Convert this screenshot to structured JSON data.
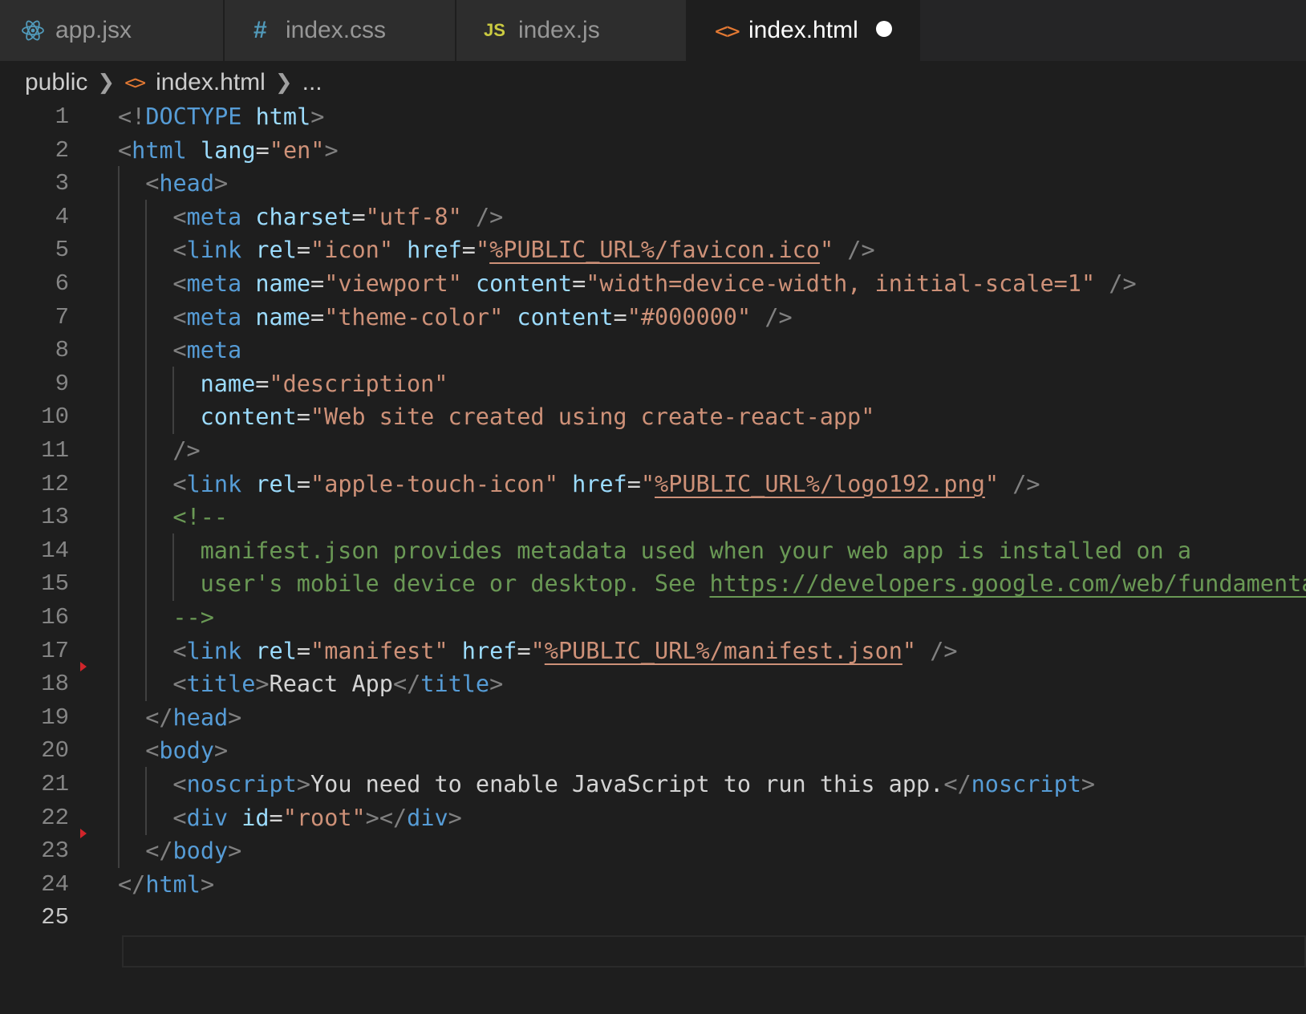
{
  "tabs": [
    {
      "label": "app.jsx",
      "icon": "react-icon"
    },
    {
      "label": "index.css",
      "icon": "css-hash-icon",
      "glyph": "#"
    },
    {
      "label": "index.js",
      "icon": "js-icon",
      "glyph": "JS"
    },
    {
      "label": "index.html",
      "icon": "html-icon",
      "glyph": "<>",
      "active": true,
      "unsaved": true
    }
  ],
  "breadcrumb": {
    "folder": "public",
    "file": "index.html",
    "more": "..."
  },
  "editor": {
    "current_line": 25,
    "lines": [
      {
        "n": "1",
        "indent": 0,
        "tokens": [
          [
            "punc",
            "<!"
          ],
          [
            "tag",
            "DOCTYPE"
          ],
          [
            "txt",
            " "
          ],
          [
            "attr",
            "html"
          ],
          [
            "punc",
            ">"
          ]
        ]
      },
      {
        "n": "2",
        "indent": 0,
        "tokens": [
          [
            "punc",
            "<"
          ],
          [
            "tag",
            "html"
          ],
          [
            "txt",
            " "
          ],
          [
            "attr",
            "lang"
          ],
          [
            "txt",
            "="
          ],
          [
            "str",
            "\"en\""
          ],
          [
            "punc",
            ">"
          ]
        ]
      },
      {
        "n": "3",
        "indent": 1,
        "tokens": [
          [
            "punc",
            "<"
          ],
          [
            "tag",
            "head"
          ],
          [
            "punc",
            ">"
          ]
        ]
      },
      {
        "n": "4",
        "indent": 2,
        "tokens": [
          [
            "punc",
            "<"
          ],
          [
            "tag",
            "meta"
          ],
          [
            "txt",
            " "
          ],
          [
            "attr",
            "charset"
          ],
          [
            "txt",
            "="
          ],
          [
            "str",
            "\"utf-8\""
          ],
          [
            "txt",
            " "
          ],
          [
            "punc",
            "/>"
          ]
        ]
      },
      {
        "n": "5",
        "indent": 2,
        "tokens": [
          [
            "punc",
            "<"
          ],
          [
            "tag",
            "link"
          ],
          [
            "txt",
            " "
          ],
          [
            "attr",
            "rel"
          ],
          [
            "txt",
            "="
          ],
          [
            "str",
            "\"icon\""
          ],
          [
            "txt",
            " "
          ],
          [
            "attr",
            "href"
          ],
          [
            "txt",
            "="
          ],
          [
            "str",
            "\""
          ],
          [
            "lstr",
            "%PUBLIC_URL%/favicon.ico"
          ],
          [
            "str",
            "\""
          ],
          [
            "txt",
            " "
          ],
          [
            "punc",
            "/>"
          ]
        ]
      },
      {
        "n": "6",
        "indent": 2,
        "tokens": [
          [
            "punc",
            "<"
          ],
          [
            "tag",
            "meta"
          ],
          [
            "txt",
            " "
          ],
          [
            "attr",
            "name"
          ],
          [
            "txt",
            "="
          ],
          [
            "str",
            "\"viewport\""
          ],
          [
            "txt",
            " "
          ],
          [
            "attr",
            "content"
          ],
          [
            "txt",
            "="
          ],
          [
            "str",
            "\"width=device-width, initial-scale=1\""
          ],
          [
            "txt",
            " "
          ],
          [
            "punc",
            "/>"
          ]
        ]
      },
      {
        "n": "7",
        "indent": 2,
        "tokens": [
          [
            "punc",
            "<"
          ],
          [
            "tag",
            "meta"
          ],
          [
            "txt",
            " "
          ],
          [
            "attr",
            "name"
          ],
          [
            "txt",
            "="
          ],
          [
            "str",
            "\"theme-color\""
          ],
          [
            "txt",
            " "
          ],
          [
            "attr",
            "content"
          ],
          [
            "txt",
            "="
          ],
          [
            "str",
            "\"#000000\""
          ],
          [
            "txt",
            " "
          ],
          [
            "punc",
            "/>"
          ]
        ]
      },
      {
        "n": "8",
        "indent": 2,
        "tokens": [
          [
            "punc",
            "<"
          ],
          [
            "tag",
            "meta"
          ]
        ]
      },
      {
        "n": "9",
        "indent": 3,
        "tokens": [
          [
            "attr",
            "name"
          ],
          [
            "txt",
            "="
          ],
          [
            "str",
            "\"description\""
          ]
        ]
      },
      {
        "n": "10",
        "indent": 3,
        "tokens": [
          [
            "attr",
            "content"
          ],
          [
            "txt",
            "="
          ],
          [
            "str",
            "\"Web site created using create-react-app\""
          ]
        ]
      },
      {
        "n": "11",
        "indent": 2,
        "tokens": [
          [
            "punc",
            "/>"
          ]
        ]
      },
      {
        "n": "12",
        "indent": 2,
        "tokens": [
          [
            "punc",
            "<"
          ],
          [
            "tag",
            "link"
          ],
          [
            "txt",
            " "
          ],
          [
            "attr",
            "rel"
          ],
          [
            "txt",
            "="
          ],
          [
            "str",
            "\"apple-touch-icon\""
          ],
          [
            "txt",
            " "
          ],
          [
            "attr",
            "href"
          ],
          [
            "txt",
            "="
          ],
          [
            "str",
            "\""
          ],
          [
            "lstr",
            "%PUBLIC_URL%/logo192.png"
          ],
          [
            "str",
            "\""
          ],
          [
            "txt",
            " "
          ],
          [
            "punc",
            "/>"
          ]
        ]
      },
      {
        "n": "13",
        "indent": 2,
        "tokens": [
          [
            "com",
            "<!--"
          ]
        ]
      },
      {
        "n": "14",
        "indent": 3,
        "tokens": [
          [
            "com",
            "manifest.json provides metadata used when your web app is installed on a"
          ]
        ]
      },
      {
        "n": "15",
        "indent": 3,
        "tokens": [
          [
            "com",
            "user's mobile device or desktop. See "
          ],
          [
            "lcom",
            "https://developers.google.com/web/fundamentals/web-app-manifest/"
          ]
        ]
      },
      {
        "n": "16",
        "indent": 2,
        "tokens": [
          [
            "com",
            "-->"
          ]
        ]
      },
      {
        "n": "17",
        "indent": 2,
        "tokens": [
          [
            "punc",
            "<"
          ],
          [
            "tag",
            "link"
          ],
          [
            "txt",
            " "
          ],
          [
            "attr",
            "rel"
          ],
          [
            "txt",
            "="
          ],
          [
            "str",
            "\"manifest\""
          ],
          [
            "txt",
            " "
          ],
          [
            "attr",
            "href"
          ],
          [
            "txt",
            "="
          ],
          [
            "str",
            "\""
          ],
          [
            "lstr",
            "%PUBLIC_URL%/manifest.json"
          ],
          [
            "str",
            "\""
          ],
          [
            "txt",
            " "
          ],
          [
            "punc",
            "/>"
          ]
        ]
      },
      {
        "n": "18",
        "indent": 2,
        "tokens": [
          [
            "punc",
            "<"
          ],
          [
            "tag",
            "title"
          ],
          [
            "punc",
            ">"
          ],
          [
            "txt",
            "React App"
          ],
          [
            "punc",
            "</"
          ],
          [
            "tag",
            "title"
          ],
          [
            "punc",
            ">"
          ]
        ]
      },
      {
        "n": "19",
        "indent": 1,
        "tokens": [
          [
            "punc",
            "</"
          ],
          [
            "tag",
            "head"
          ],
          [
            "punc",
            ">"
          ]
        ]
      },
      {
        "n": "20",
        "indent": 1,
        "tokens": [
          [
            "punc",
            "<"
          ],
          [
            "tag",
            "body"
          ],
          [
            "punc",
            ">"
          ]
        ]
      },
      {
        "n": "21",
        "indent": 2,
        "tokens": [
          [
            "punc",
            "<"
          ],
          [
            "tag",
            "noscript"
          ],
          [
            "punc",
            ">"
          ],
          [
            "txt",
            "You need to enable JavaScript to run this app."
          ],
          [
            "punc",
            "</"
          ],
          [
            "tag",
            "noscript"
          ],
          [
            "punc",
            ">"
          ]
        ]
      },
      {
        "n": "22",
        "indent": 2,
        "tokens": [
          [
            "punc",
            "<"
          ],
          [
            "tag",
            "div"
          ],
          [
            "txt",
            " "
          ],
          [
            "attr",
            "id"
          ],
          [
            "txt",
            "="
          ],
          [
            "str",
            "\"root\""
          ],
          [
            "punc",
            "></"
          ],
          [
            "tag",
            "div"
          ],
          [
            "punc",
            ">"
          ]
        ]
      },
      {
        "n": "23",
        "indent": 1,
        "tokens": [
          [
            "punc",
            "</"
          ],
          [
            "tag",
            "body"
          ],
          [
            "punc",
            ">"
          ]
        ]
      },
      {
        "n": "24",
        "indent": 0,
        "tokens": [
          [
            "punc",
            "</"
          ],
          [
            "tag",
            "html"
          ],
          [
            "punc",
            ">"
          ]
        ]
      },
      {
        "n": "25",
        "indent": 0,
        "tokens": []
      }
    ]
  },
  "colors": {
    "background": "#1e1e1e",
    "tag": "#569cd6",
    "attribute": "#9cdcfe",
    "string": "#ce9178",
    "comment": "#6a9955",
    "git_marker": "#d0252b"
  }
}
